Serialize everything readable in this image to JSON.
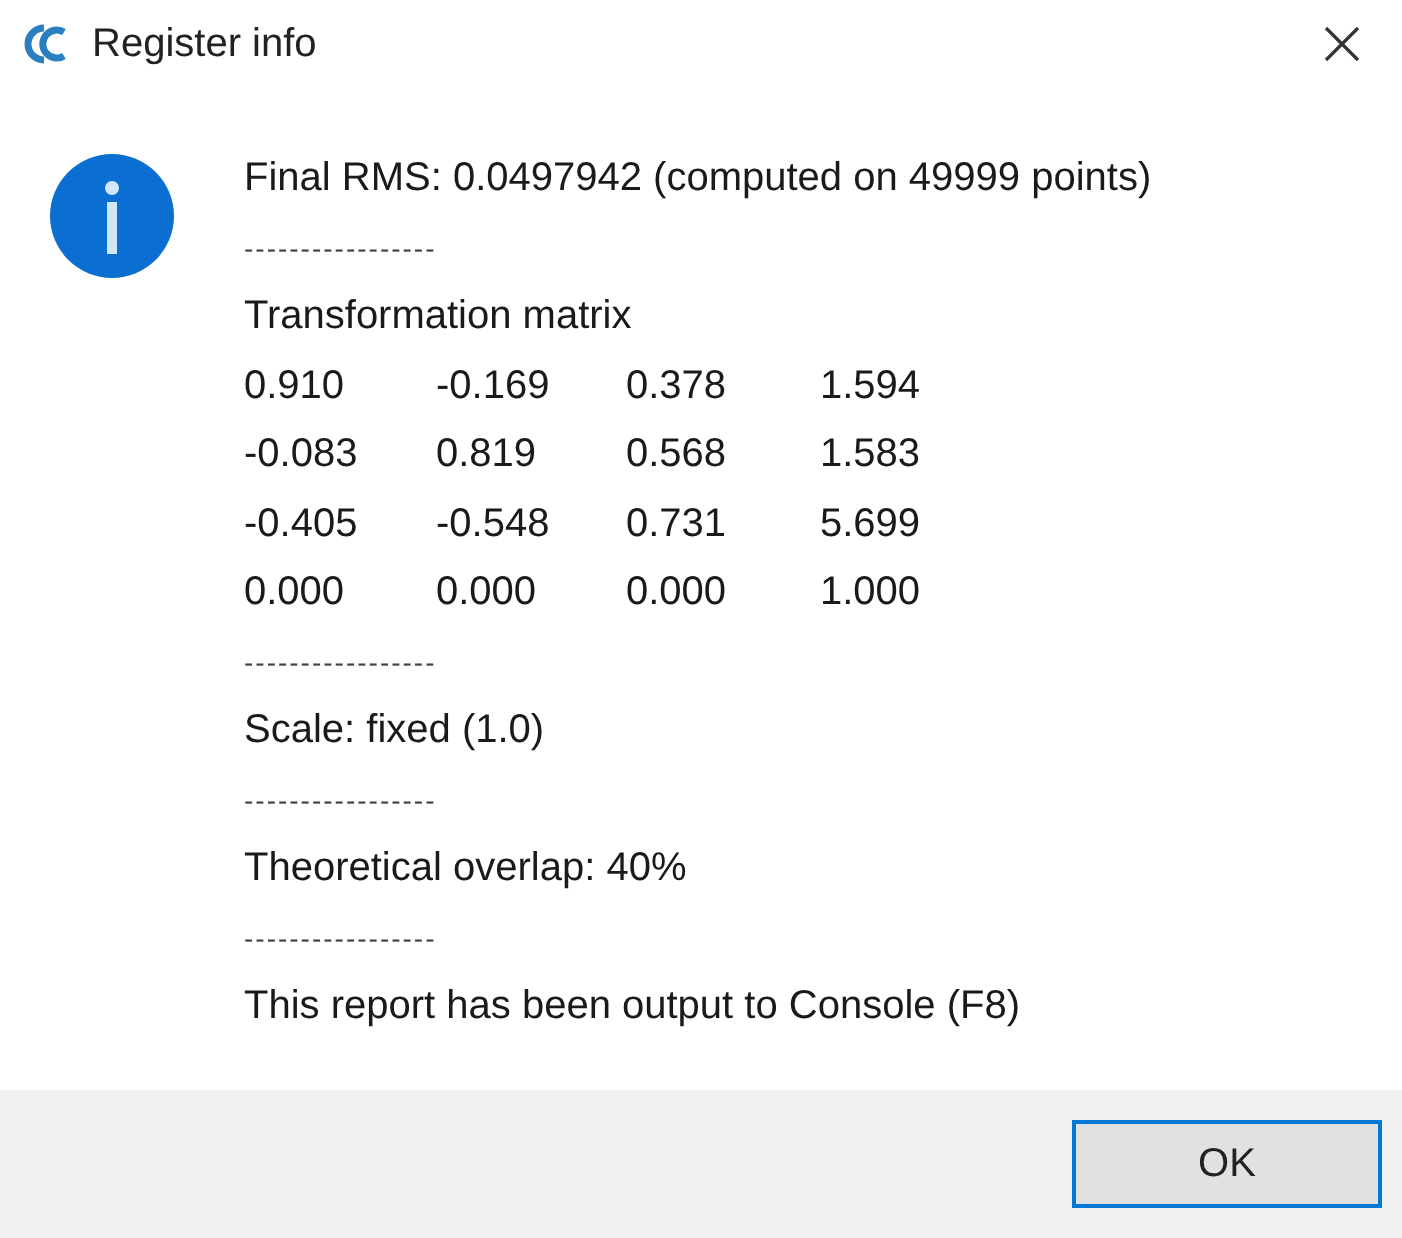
{
  "window": {
    "title": "Register info"
  },
  "message": [
    {
      "kind": "text",
      "text": "Final RMS: 0.0497942 (computed on 49999 points)"
    },
    {
      "kind": "separator",
      "text": "-----------------"
    },
    {
      "kind": "text",
      "text": "Transformation matrix"
    },
    {
      "kind": "matrix",
      "rows": [
        [
          "0.910",
          "-0.169",
          "0.378",
          "1.594"
        ],
        [
          "-0.083",
          "0.819",
          "0.568",
          "1.583"
        ],
        [
          "-0.405",
          "-0.548",
          "0.731",
          "5.699"
        ],
        [
          "0.000",
          "0.000",
          "0.000",
          "1.000"
        ]
      ]
    },
    {
      "kind": "separator",
      "text": "-----------------"
    },
    {
      "kind": "text",
      "text": "Scale: fixed (1.0)"
    },
    {
      "kind": "separator",
      "text": "-----------------"
    },
    {
      "kind": "text",
      "text": "Theoretical overlap: 40%"
    },
    {
      "kind": "separator",
      "text": "-----------------"
    },
    {
      "kind": "text",
      "text": "This report has been output to Console (F8)"
    }
  ],
  "buttons": [
    {
      "label": "OK",
      "focused": true
    }
  ]
}
